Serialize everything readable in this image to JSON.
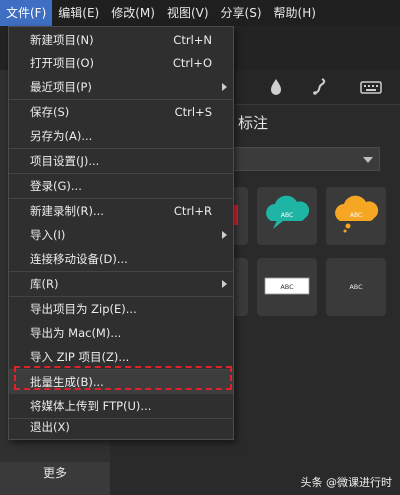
{
  "menubar": {
    "items": [
      "文件(F)",
      "编辑(E)",
      "修改(M)",
      "视图(V)",
      "分享(S)",
      "帮助(H)"
    ]
  },
  "file_menu": {
    "items": [
      {
        "label": "新建项目(N)",
        "shortcut": "Ctrl+N"
      },
      {
        "label": "打开项目(O)",
        "shortcut": "Ctrl+O"
      },
      {
        "label": "最近项目(P)",
        "submenu": true
      },
      {
        "label": "保存(S)",
        "shortcut": "Ctrl+S"
      },
      {
        "label": "另存为(A)..."
      },
      {
        "label": "项目设置(J)..."
      },
      {
        "label": "登录(G)..."
      },
      {
        "label": "新建录制(R)...",
        "shortcut": "Ctrl+R"
      },
      {
        "label": "导入(I)",
        "submenu": true
      },
      {
        "label": "连接移动设备(D)..."
      },
      {
        "label": "库(R)",
        "submenu": true
      },
      {
        "label": "导出项目为 Zip(E)..."
      },
      {
        "label": "导出为 Mac(M)..."
      },
      {
        "label": "导入 ZIP 项目(Z)..."
      },
      {
        "label": "批量生成(B)...",
        "highlighted": true
      },
      {
        "label": "将媒体上传到 FTP(U)..."
      },
      {
        "label": "退出(X)"
      }
    ]
  },
  "panel": {
    "title": "标注",
    "more_label": "更多",
    "tiles": [
      "ABC",
      "ABC",
      "ABC",
      "ABC"
    ]
  },
  "watermark": "头条 @微课进行时",
  "colors": {
    "active_menu": "#3e6fc3",
    "highlight_box": "#e0202a",
    "callout_teal": "#1fb5a5",
    "callout_orange": "#f5a623"
  }
}
